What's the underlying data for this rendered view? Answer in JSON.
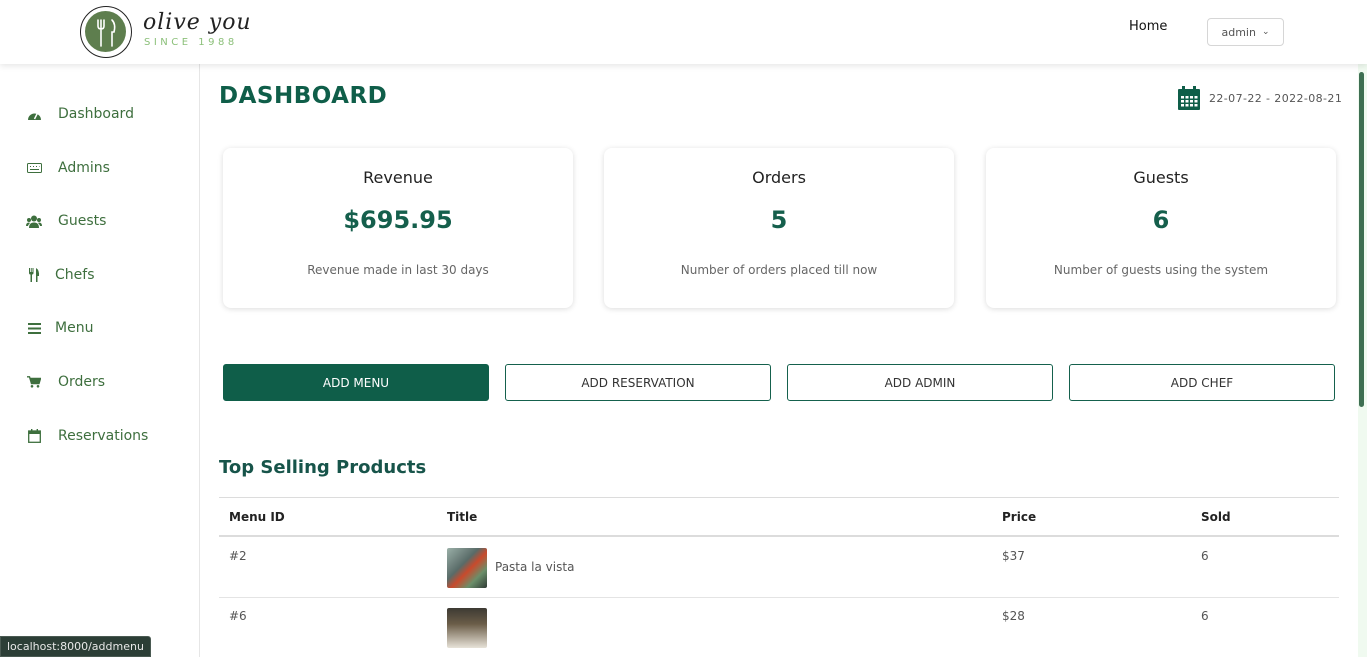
{
  "header": {
    "brand_name": "olive you",
    "brand_sub": "SINCE 1988",
    "home_label": "Home",
    "user_label": "admin"
  },
  "sidebar": {
    "items": [
      {
        "label": "Dashboard",
        "icon": "dashboard-icon"
      },
      {
        "label": "Admins",
        "icon": "keyboard-icon"
      },
      {
        "label": "Guests",
        "icon": "users-icon"
      },
      {
        "label": "Chefs",
        "icon": "utensils-icon"
      },
      {
        "label": "Menu",
        "icon": "bars-icon"
      },
      {
        "label": "Orders",
        "icon": "cart-icon"
      },
      {
        "label": "Reservations",
        "icon": "calendar-icon"
      }
    ]
  },
  "main": {
    "title": "DASHBOARD",
    "date_range": "22-07-22 - 2022-08-21",
    "cards": [
      {
        "title": "Revenue",
        "value": "$695.95",
        "desc": "Revenue made in last 30 days"
      },
      {
        "title": "Orders",
        "value": "5",
        "desc": "Number of orders placed till now"
      },
      {
        "title": "Guests",
        "value": "6",
        "desc": "Number of guests using the system"
      }
    ],
    "actions": [
      "ADD MENU",
      "ADD RESERVATION",
      "ADD ADMIN",
      "ADD CHEF"
    ],
    "section_title": "Top Selling Products",
    "table": {
      "headers": [
        "Menu ID",
        "Title",
        "Price",
        "Sold"
      ],
      "rows": [
        {
          "id": "#2",
          "title": "Pasta la vista",
          "price": "$37",
          "sold": "6"
        },
        {
          "id": "#6",
          "title": "",
          "price": "$28",
          "sold": "6"
        }
      ]
    }
  },
  "status_bar": {
    "url": "localhost:8000/addmenu"
  },
  "colors": {
    "primary": "#0f5e49",
    "sidebar_text": "#3e6f3e",
    "logo_green": "#5e7e4e"
  }
}
